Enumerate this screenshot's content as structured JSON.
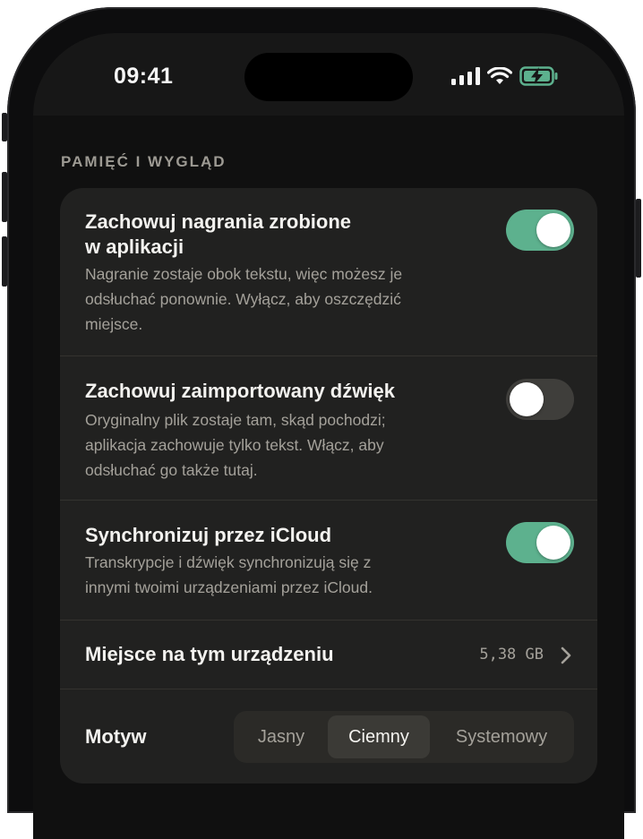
{
  "status_bar": {
    "time": "09:41",
    "icons": [
      "signal-icon",
      "wifi-icon",
      "battery-charging-icon"
    ],
    "battery_color": "#5db18e"
  },
  "section": {
    "header": "PAMIĘĆ I WYGLĄD"
  },
  "settings": {
    "keep_recordings": {
      "title_line1": "Zachowuj nagrania zrobione",
      "title_line2": "w aplikacji",
      "desc_line1": "Nagranie zostaje obok tekstu, więc możesz je",
      "desc_line2": "odsłuchać ponownie. Wyłącz, aby oszczędzić",
      "desc_line3": "miejsce.",
      "enabled": true
    },
    "keep_imported": {
      "title": "Zachowuj zaimportowany dźwięk",
      "desc_line1": "Oryginalny plik zostaje tam, skąd pochodzi;",
      "desc_line2": "aplikacja zachowuje tylko tekst. Włącz, aby",
      "desc_line3": "odsłuchać go także tutaj.",
      "enabled": false
    },
    "icloud_sync": {
      "title": "Synchronizuj przez iCloud",
      "desc_line1": "Transkrypcje i dźwięk synchronizują się z",
      "desc_line2": "innymi twoimi urządzeniami przez iCloud.",
      "enabled": true
    },
    "storage": {
      "title": "Miejsce na tym urządzeniu",
      "value": "5,38 GB"
    },
    "theme": {
      "title": "Motyw",
      "options": [
        "Jasny",
        "Ciemny",
        "Systemowy"
      ],
      "selected": "Ciemny"
    }
  },
  "colors": {
    "accent": "#5db18e",
    "card_background": "#212120",
    "screen_background": "#101010"
  }
}
